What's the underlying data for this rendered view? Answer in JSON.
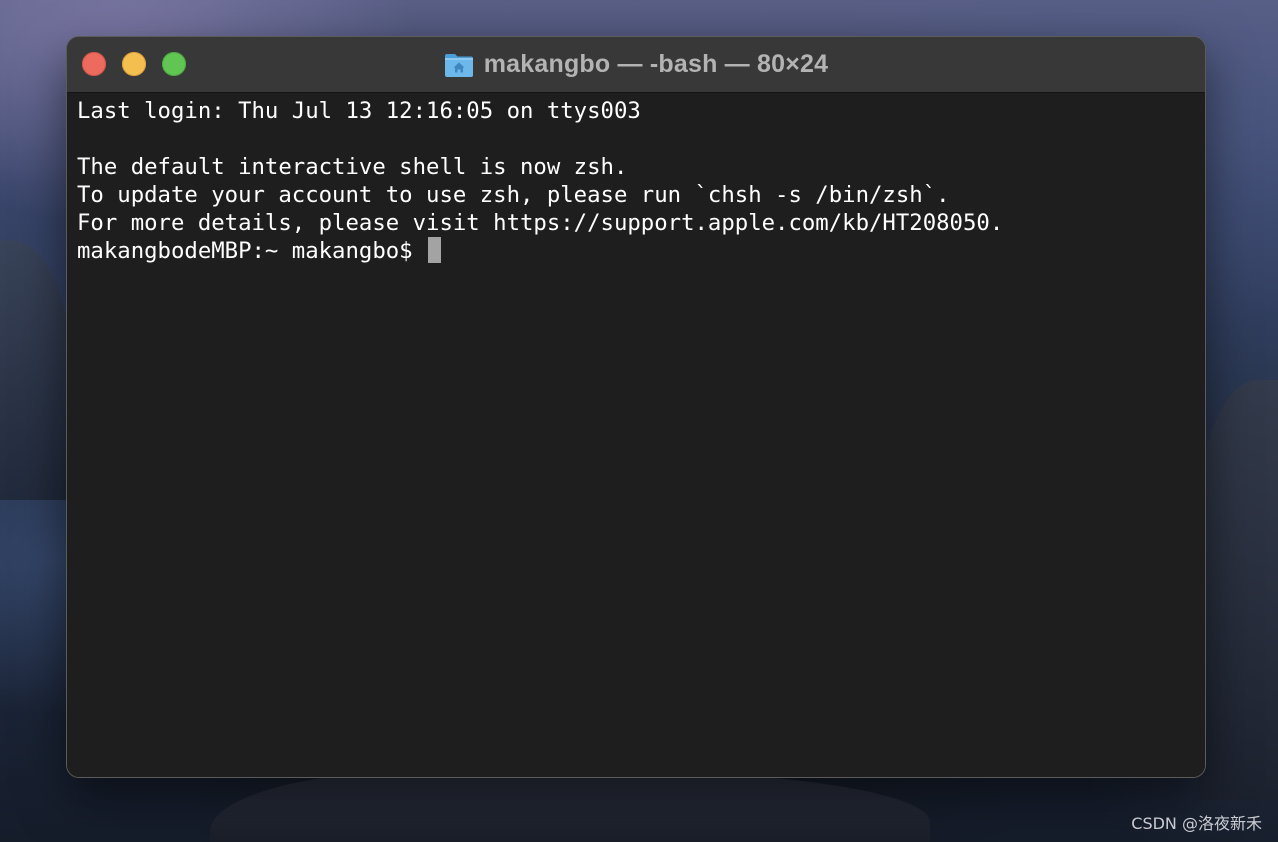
{
  "window": {
    "title": "makangbo — -bash — 80×24",
    "title_icon": "home-folder-icon"
  },
  "traffic_lights": {
    "close_color": "#ed6a5e",
    "minimize_color": "#f5bf4f",
    "zoom_color": "#61c554"
  },
  "terminal": {
    "lines": [
      "Last login: Thu Jul 13 12:16:05 on ttys003",
      "",
      "The default interactive shell is now zsh.",
      "To update your account to use zsh, please run `chsh -s /bin/zsh`.",
      "For more details, please visit https://support.apple.com/kb/HT208050."
    ],
    "prompt": "makangbodeMBP:~ makangbo$ ",
    "background_color": "#1e1e1e",
    "text_color": "#ffffff"
  },
  "watermark": "CSDN @洛夜新禾"
}
